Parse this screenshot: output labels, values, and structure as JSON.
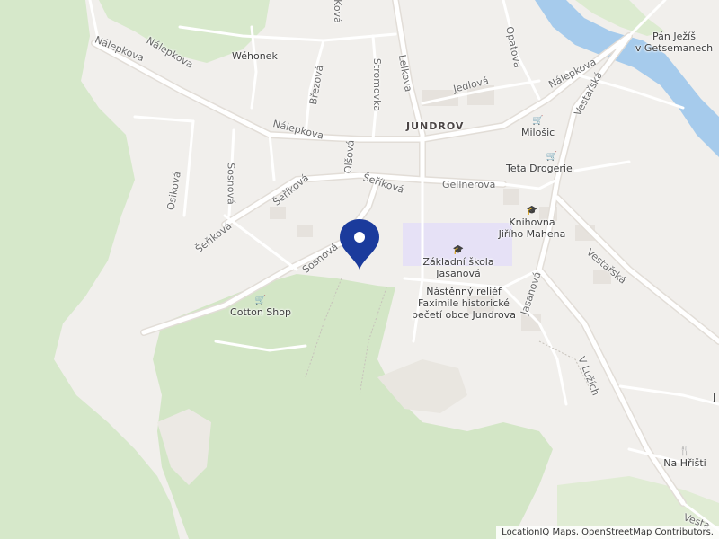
{
  "map": {
    "district": "JUNDROV",
    "streets": {
      "nalepkova_1": "Nálepkova",
      "nalepkova_2": "Nálepkova",
      "nalepkova_3": "Nálepkova",
      "nalepkova_4": "Nálepkova",
      "brezova": "Březová",
      "olsova": "Olšová",
      "stromovka": "Stromovka",
      "lelkova": "Lelkova",
      "jedlova": "Jedlová",
      "opatova": "Opatova",
      "vestarska_1": "Vestařská",
      "vestarska_2": "Vestařská",
      "serikova_1": "Šeříková",
      "serikova_2": "Šeříková",
      "serikova_3": "Šeříková",
      "gellnerova": "Gellnerova",
      "osikova": "Osiková",
      "sosnova_1": "Sosnová",
      "sosnova_2": "Sosnová",
      "jasanova": "Jasanová",
      "v_luzich": "V Lužích",
      "top_street": "Ková",
      "bottom_right_fragment": "Vesta"
    },
    "places": {
      "wehonek": "Wéhonek",
      "milosic": "Milošic",
      "teta_drogerie": "Teta Drogerie",
      "knihovna_1": "Knihovna",
      "knihovna_2": "Jiřího Mahena",
      "zakladni_skola_1": "Základní škola",
      "zakladni_skola_2": "Jasanová",
      "relief_1": "Nástěnný reliéf",
      "relief_2": "Faximile historické",
      "relief_3": "pečetí obce Jundrova",
      "cotton_shop": "Cotton Shop",
      "na_hristi": "Na Hřišti",
      "pan_jezis_1": "Pán Ježíš",
      "pan_jezis_2": "v Getsemanech",
      "edge_fragment": "J"
    },
    "icons": {
      "shop": "basket-icon",
      "school": "graduation-cap-icon",
      "restaurant": "fork-knife-icon",
      "marker": "location-pin-icon"
    },
    "colors": {
      "land": "#f1efec",
      "forest": "#d6e8ca",
      "forest_dark": "#cfe3c2",
      "water": "#a6cbec",
      "road": "#ffffff",
      "road_casing": "#e3ded8",
      "school_area": "#e8e3f7",
      "marker": "#1b3b9c"
    },
    "attribution": "LocationIQ Maps, OpenStreetMap Contributors."
  }
}
